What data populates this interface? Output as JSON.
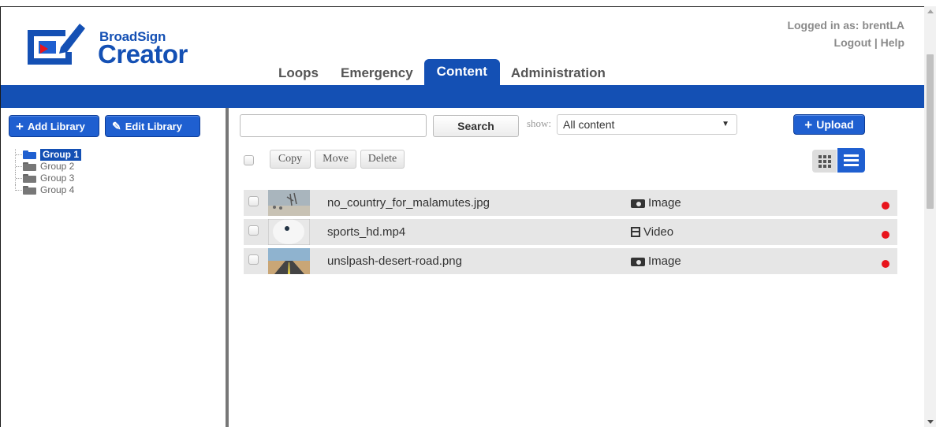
{
  "brand": {
    "small": "BroadSign",
    "big": "Creator"
  },
  "session": {
    "logged_in_as": "Logged in as: brentLA",
    "logout": "Logout",
    "separator": " | ",
    "help": "Help"
  },
  "tabs": [
    {
      "label": "Loops",
      "active": false
    },
    {
      "label": "Emergency",
      "active": false
    },
    {
      "label": "Content",
      "active": true
    },
    {
      "label": "Administration",
      "active": false
    }
  ],
  "library": {
    "add_label": "Add Library",
    "edit_label": "Edit Library",
    "groups": [
      {
        "label": "Group 1",
        "selected": true
      },
      {
        "label": "Group 2",
        "selected": false
      },
      {
        "label": "Group 3",
        "selected": false
      },
      {
        "label": "Group 4",
        "selected": false
      }
    ]
  },
  "toolbar": {
    "search_value": "",
    "search_label": "Search",
    "show_label": "show:",
    "show_value": "All content",
    "upload_label": "Upload",
    "copy_label": "Copy",
    "move_label": "Move",
    "delete_label": "Delete",
    "view_mode": "list"
  },
  "items": [
    {
      "name": "no_country_for_malamutes.jpg",
      "type": "Image",
      "type_icon": "camera-icon",
      "status_color": "#e8141c"
    },
    {
      "name": "sports_hd.mp4",
      "type": "Video",
      "type_icon": "film-icon",
      "status_color": "#e8141c"
    },
    {
      "name": "unslpash-desert-road.png",
      "type": "Image",
      "type_icon": "camera-icon",
      "status_color": "#e8141c"
    }
  ],
  "colors": {
    "brand_blue": "#1450b4",
    "button_blue": "#1f5fd0",
    "status_red": "#e8141c"
  }
}
